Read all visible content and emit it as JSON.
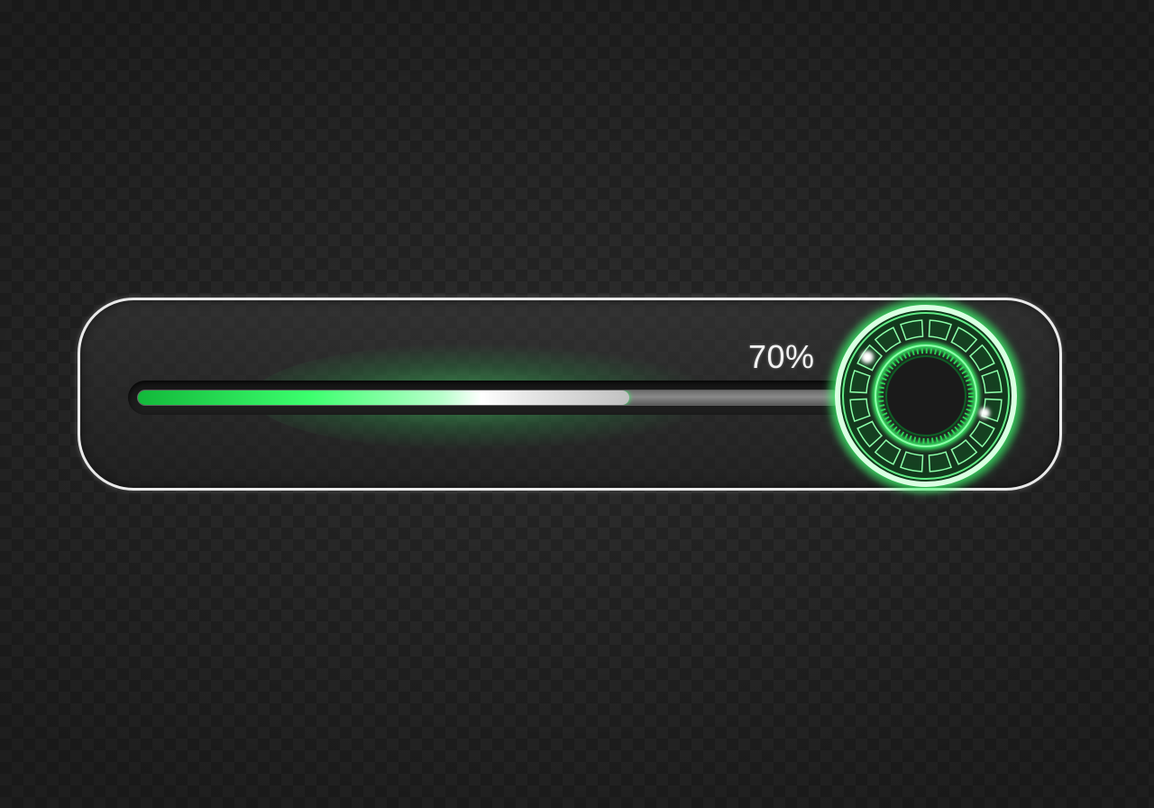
{
  "progress": {
    "percent_label": "70%",
    "value": 0.7
  },
  "colors": {
    "accent": "#3cff6e",
    "accent_dark": "#12b83a",
    "frame": "#e9e9e9"
  },
  "icons": {
    "knob": "circular-gauge-icon"
  }
}
